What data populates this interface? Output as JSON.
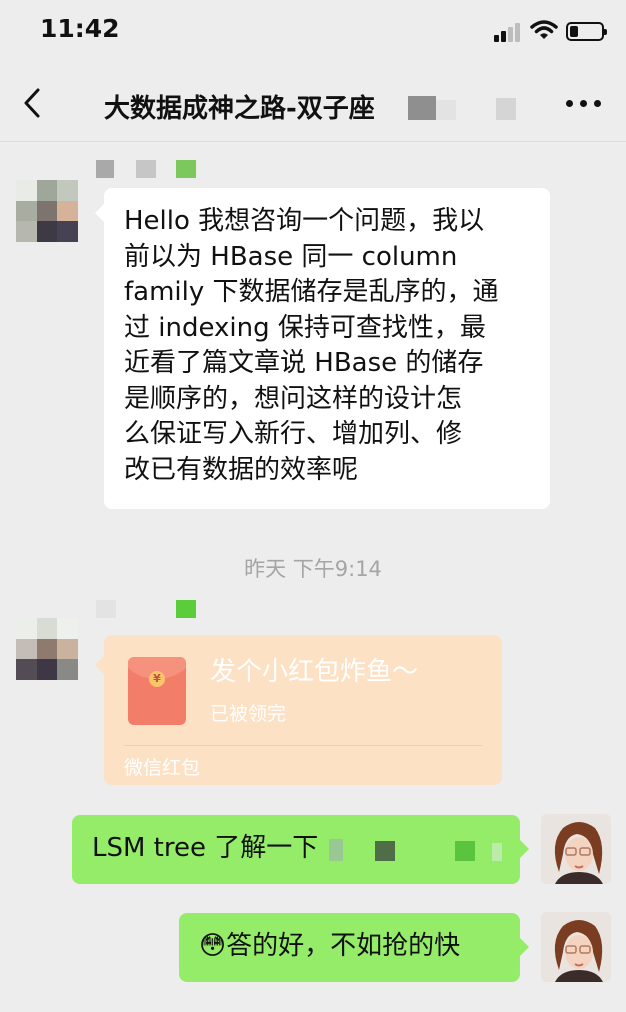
{
  "status_bar": {
    "time": "11:42"
  },
  "nav": {
    "title": "大数据成神之路-双子座"
  },
  "messages": {
    "m1": {
      "lines": [
        "Hello 我想咨询一个问题，我以",
        "前以为 HBase 同一 column",
        "family 下数据储存是乱序的，通",
        "过 indexing 保持可查找性，最",
        "近看了篇文章说 HBase 的储存",
        "是顺序的，想问这样的设计怎",
        "么保证写入新行、增加列、修",
        "改已有数据的效率呢"
      ]
    },
    "timestamp": "昨天 下午9:14",
    "red_packet": {
      "title": "发个小红包炸鱼～",
      "status": "已被领完",
      "label": "微信红包"
    },
    "m3": {
      "text": "LSM tree 了解一下"
    },
    "m4": {
      "emoji": "😳",
      "text": "答的好，不如抢的快"
    }
  },
  "colors": {
    "background": "#ededed",
    "sent_bubble": "#95ec69",
    "red_packet": "#fde1c4"
  },
  "icons": [
    "signal-icon",
    "wifi-icon",
    "battery-icon",
    "back-chevron-icon",
    "more-icon",
    "red-packet-icon"
  ]
}
